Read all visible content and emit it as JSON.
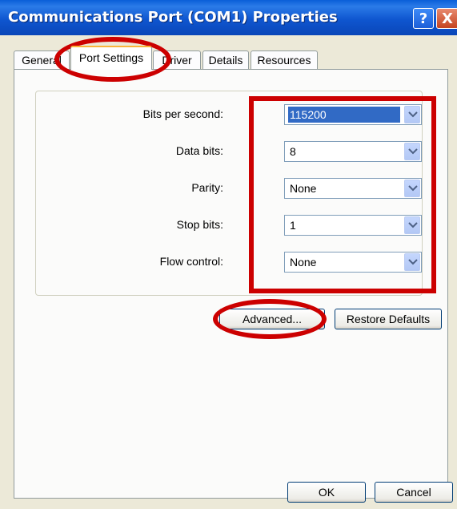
{
  "window": {
    "title": "Communications Port (COM1) Properties"
  },
  "title_buttons": {
    "help_label": "?",
    "close_label": "X"
  },
  "tabs": [
    {
      "label": "General"
    },
    {
      "label": "Port Settings"
    },
    {
      "label": "Driver"
    },
    {
      "label": "Details"
    },
    {
      "label": "Resources"
    }
  ],
  "active_tab": "Port Settings",
  "settings": [
    {
      "label": "Bits per second:",
      "value": "115200"
    },
    {
      "label": "Data bits:",
      "value": "8"
    },
    {
      "label": "Parity:",
      "value": "None"
    },
    {
      "label": "Stop bits:",
      "value": "1"
    },
    {
      "label": "Flow control:",
      "value": "None"
    }
  ],
  "buttons": {
    "advanced": "Advanced...",
    "restore_defaults": "Restore Defaults",
    "ok": "OK",
    "cancel": "Cancel"
  },
  "colors": {
    "titlebar": "#0a56d0",
    "highlight": "#316ac5",
    "annotation": "#cc0000"
  }
}
